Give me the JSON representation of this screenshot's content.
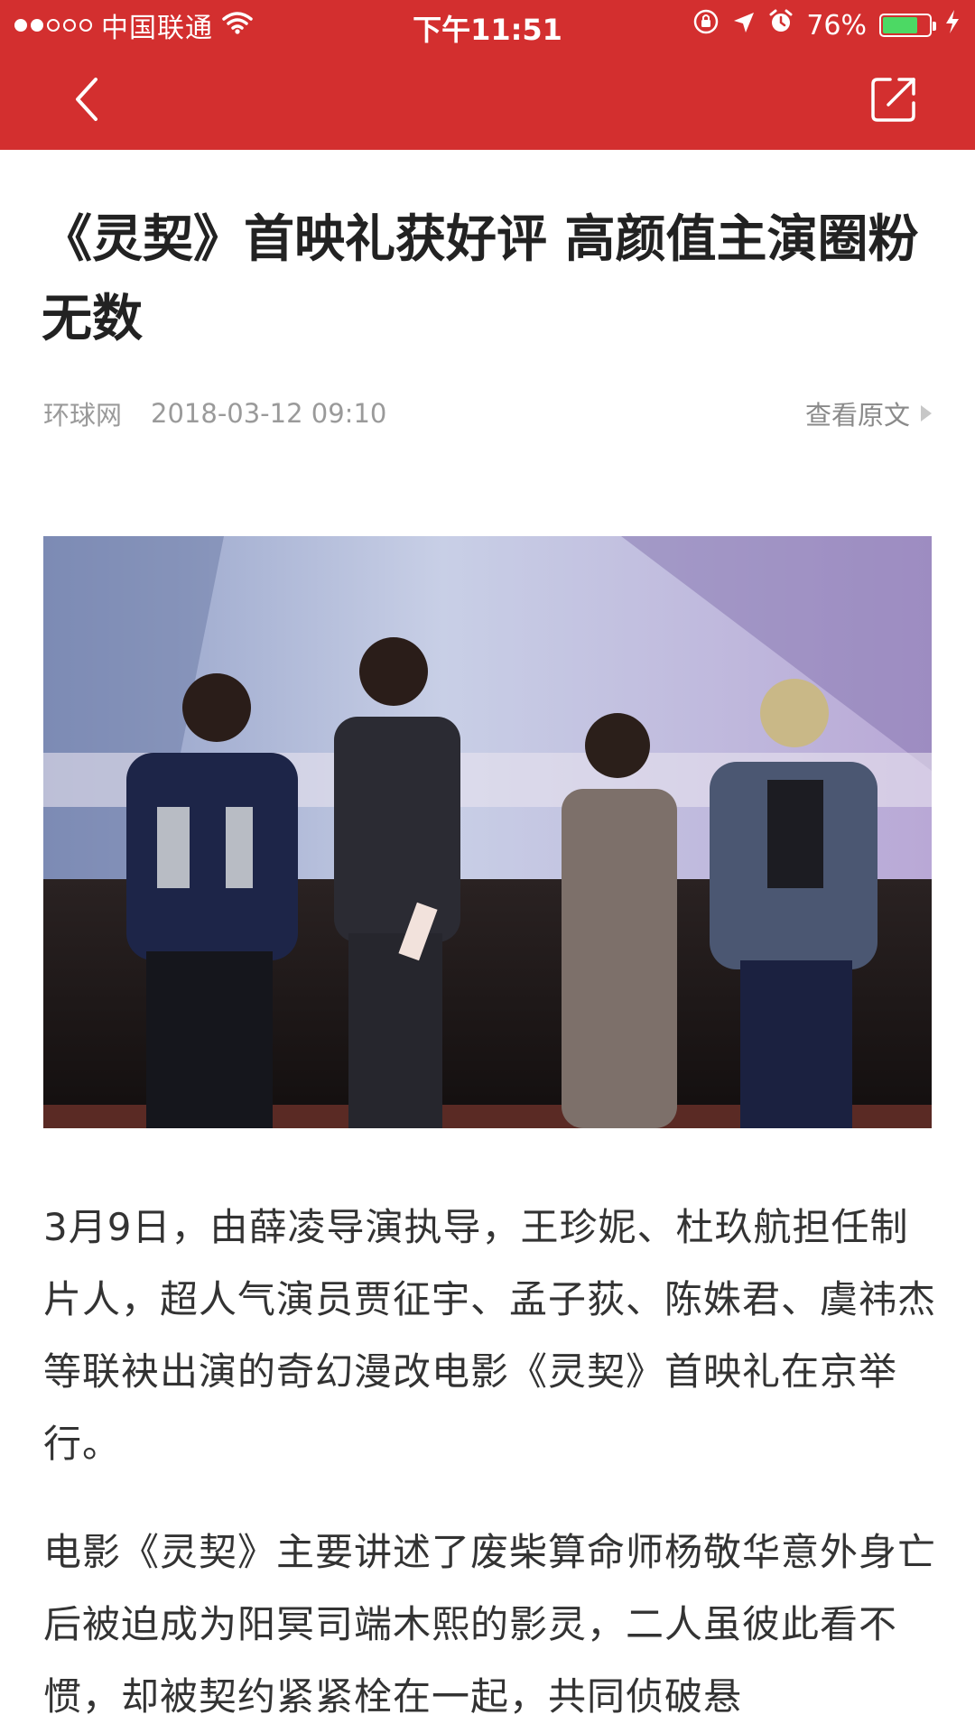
{
  "status_bar": {
    "carrier": "中国联通",
    "time": "下午11:51",
    "battery_percent": "76%",
    "battery_level": 0.76,
    "signal_bars": 2
  },
  "nav": {
    "back_icon": "chevron-left-icon",
    "share_icon": "share-external-icon"
  },
  "article": {
    "title": "《灵契》首映礼获好评 高颜值主演圈粉无数",
    "source": "环球网",
    "datetime": "2018-03-12 09:10",
    "view_original": "查看原文",
    "paragraphs": [
      "3月9日，由薛凌导演执导，王珍妮、杜玖航担任制片人，超人气演员贾征宇、孟子荻、陈姝君、虞祎杰等联袂出演的奇幻漫改电影《灵契》首映礼在京举行。",
      "电影《灵契》主要讲述了废柴算命师杨敬华意外身亡后被迫成为阳冥司端木熙的影灵，二人虽彼此看不惯，却被契约紧紧栓在一起，共同侦破悬"
    ]
  },
  "colors": {
    "header_red": "#d32f2f",
    "battery_green": "#4cd964",
    "meta_gray": "#9a9a9a",
    "body_text": "#333333"
  }
}
